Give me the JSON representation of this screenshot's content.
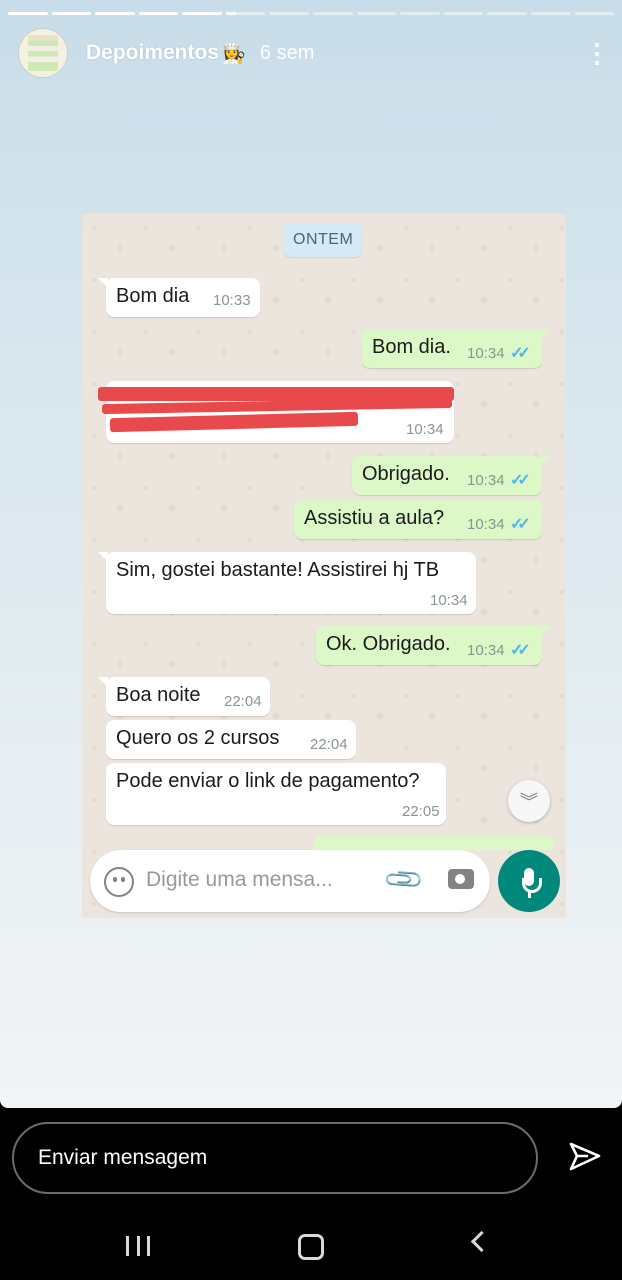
{
  "story": {
    "account_name": "Depoimentos",
    "account_emoji": "👩‍🍳",
    "time_ago": "6 sem",
    "progress": {
      "segments": 14,
      "completed": 5,
      "current_fraction": 0.25
    }
  },
  "chat": {
    "date_label": "ONTEM",
    "messages": [
      {
        "dir": "in",
        "text": "Bom dia",
        "time": "10:33"
      },
      {
        "dir": "out",
        "text": "Bom dia.",
        "time": "10:34",
        "ticks": "✓✓"
      },
      {
        "dir": "in",
        "text": "",
        "time": "10:34",
        "redacted": true
      },
      {
        "dir": "out",
        "text": "Obrigado.",
        "time": "10:34",
        "ticks": "✓✓"
      },
      {
        "dir": "out",
        "text": "Assistiu a aula?",
        "time": "10:34",
        "ticks": "✓✓"
      },
      {
        "dir": "in",
        "text": "Sim, gostei bastante! Assistirei hj TB",
        "time": "10:34"
      },
      {
        "dir": "out",
        "text": "Ok. Obrigado.",
        "time": "10:34",
        "ticks": "✓✓"
      },
      {
        "dir": "in",
        "text": "Boa noite",
        "time": "22:04"
      },
      {
        "dir": "in",
        "text": "Quero os 2 cursos",
        "time": "22:04"
      },
      {
        "dir": "in",
        "text": "Pode enviar o link de pagamento?",
        "time": "22:05"
      }
    ],
    "composer_placeholder": "Digite uma mensa...",
    "icons": {
      "emoji": "emoji-icon",
      "attach": "paperclip-icon",
      "camera": "camera-icon",
      "mic": "microphone-icon",
      "scroll": "double-chevron-down-icon"
    },
    "colors": {
      "incoming": "#ffffff",
      "outgoing": "#dcf8c6",
      "read_ticks": "#4fb7ec",
      "mic_button": "#00897b"
    }
  },
  "reply_bar": {
    "placeholder": "Enviar mensagem",
    "send_icon": "send-icon"
  },
  "system_nav": {
    "recent": "recent-apps-icon",
    "home": "home-icon",
    "back": "back-icon"
  }
}
